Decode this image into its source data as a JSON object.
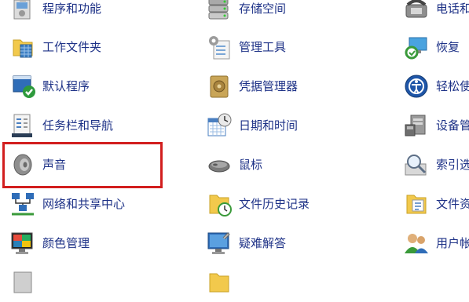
{
  "control_panel": {
    "items": [
      {
        "label": "程序和功能",
        "icon": "programs-features-icon"
      },
      {
        "label": "存储空间",
        "icon": "storage-spaces-icon"
      },
      {
        "label": "电话和",
        "icon": "phone-modem-icon"
      },
      {
        "label": "工作文件夹",
        "icon": "work-folders-icon"
      },
      {
        "label": "管理工具",
        "icon": "admin-tools-icon"
      },
      {
        "label": "恢复",
        "icon": "recovery-icon"
      },
      {
        "label": "默认程序",
        "icon": "default-programs-icon"
      },
      {
        "label": "凭据管理器",
        "icon": "credential-manager-icon"
      },
      {
        "label": "轻松使",
        "icon": "ease-of-access-icon"
      },
      {
        "label": "任务栏和导航",
        "icon": "taskbar-navigation-icon"
      },
      {
        "label": "日期和时间",
        "icon": "date-time-icon"
      },
      {
        "label": "设备管",
        "icon": "device-manager-icon"
      },
      {
        "label": "声音",
        "icon": "sound-icon"
      },
      {
        "label": "鼠标",
        "icon": "mouse-icon"
      },
      {
        "label": "索引选",
        "icon": "indexing-options-icon"
      },
      {
        "label": "网络和共享中心",
        "icon": "network-sharing-icon"
      },
      {
        "label": "文件历史记录",
        "icon": "file-history-icon"
      },
      {
        "label": "文件资",
        "icon": "file-explorer-options-icon"
      },
      {
        "label": "颜色管理",
        "icon": "color-management-icon"
      },
      {
        "label": "疑难解答",
        "icon": "troubleshooting-icon"
      },
      {
        "label": "用户帐",
        "icon": "user-accounts-icon"
      }
    ],
    "highlighted_item": "声音",
    "highlight_color": "#d21e1e",
    "label_color": "#1e3287"
  }
}
